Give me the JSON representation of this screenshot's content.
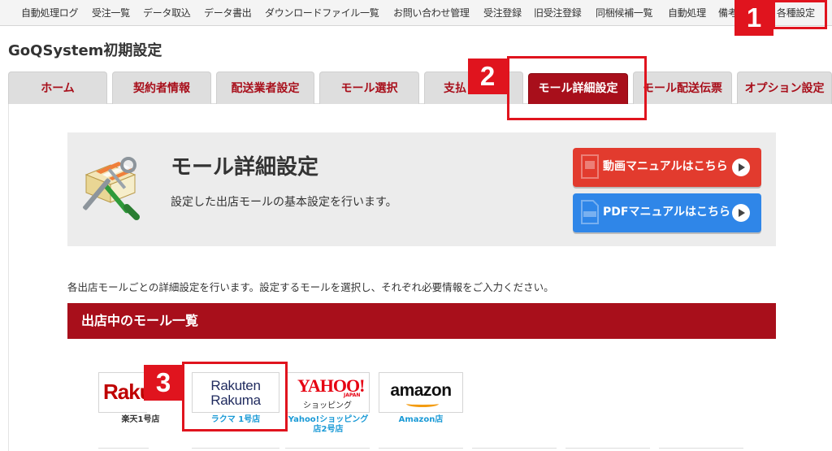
{
  "top_nav": {
    "items": [
      "自動処理ログ",
      "受注一覧",
      "データ取込",
      "データ書出",
      "ダウンロードファイル一覧",
      "お問い合わせ管理",
      "受注登録",
      "旧受注登録",
      "同梱候補一覧",
      "自動処理",
      "備考"
    ],
    "settings_label": "各種設定"
  },
  "markers": [
    "1",
    "2",
    "3"
  ],
  "page_title": "GoQSystem初期設定",
  "tabs": [
    "ホーム",
    "契約者情報",
    "配送業者設定",
    "モール選択",
    "支払",
    "モール詳細設定",
    "モール配送伝票",
    "オプション設定"
  ],
  "active_tab": "モール詳細設定",
  "hero": {
    "title": "モール詳細設定",
    "description": "設定した出店モールの基本設定を行います。",
    "video_button": "動画マニュアルはこちら",
    "pdf_button": "PDFマニュアルはこちら"
  },
  "intro": "各出店モールごとの詳細設定を行います。設定するモールを選択し、それぞれ必要情報をご入力ください。",
  "section_title": "出店中のモール一覧",
  "malls": [
    {
      "logo": "Raku",
      "label": "楽天1号店"
    },
    {
      "logo_line1": "Rakuten",
      "logo_line2": "Rakuma",
      "label": "ラクマ 1号店"
    },
    {
      "logo": "YAHOO!",
      "logo_sub": "JAPAN",
      "logo_caption": "ショッピング",
      "label": "Yahoo!ショッピング店2号店"
    },
    {
      "logo": "amazon",
      "label": "Amazon店"
    }
  ],
  "colors": {
    "accent_red": "#a80f1b",
    "marker_red": "#e0141e",
    "video_button": "#e23b2e",
    "pdf_button": "#2f86e8",
    "link_blue": "#1a9ad6"
  }
}
